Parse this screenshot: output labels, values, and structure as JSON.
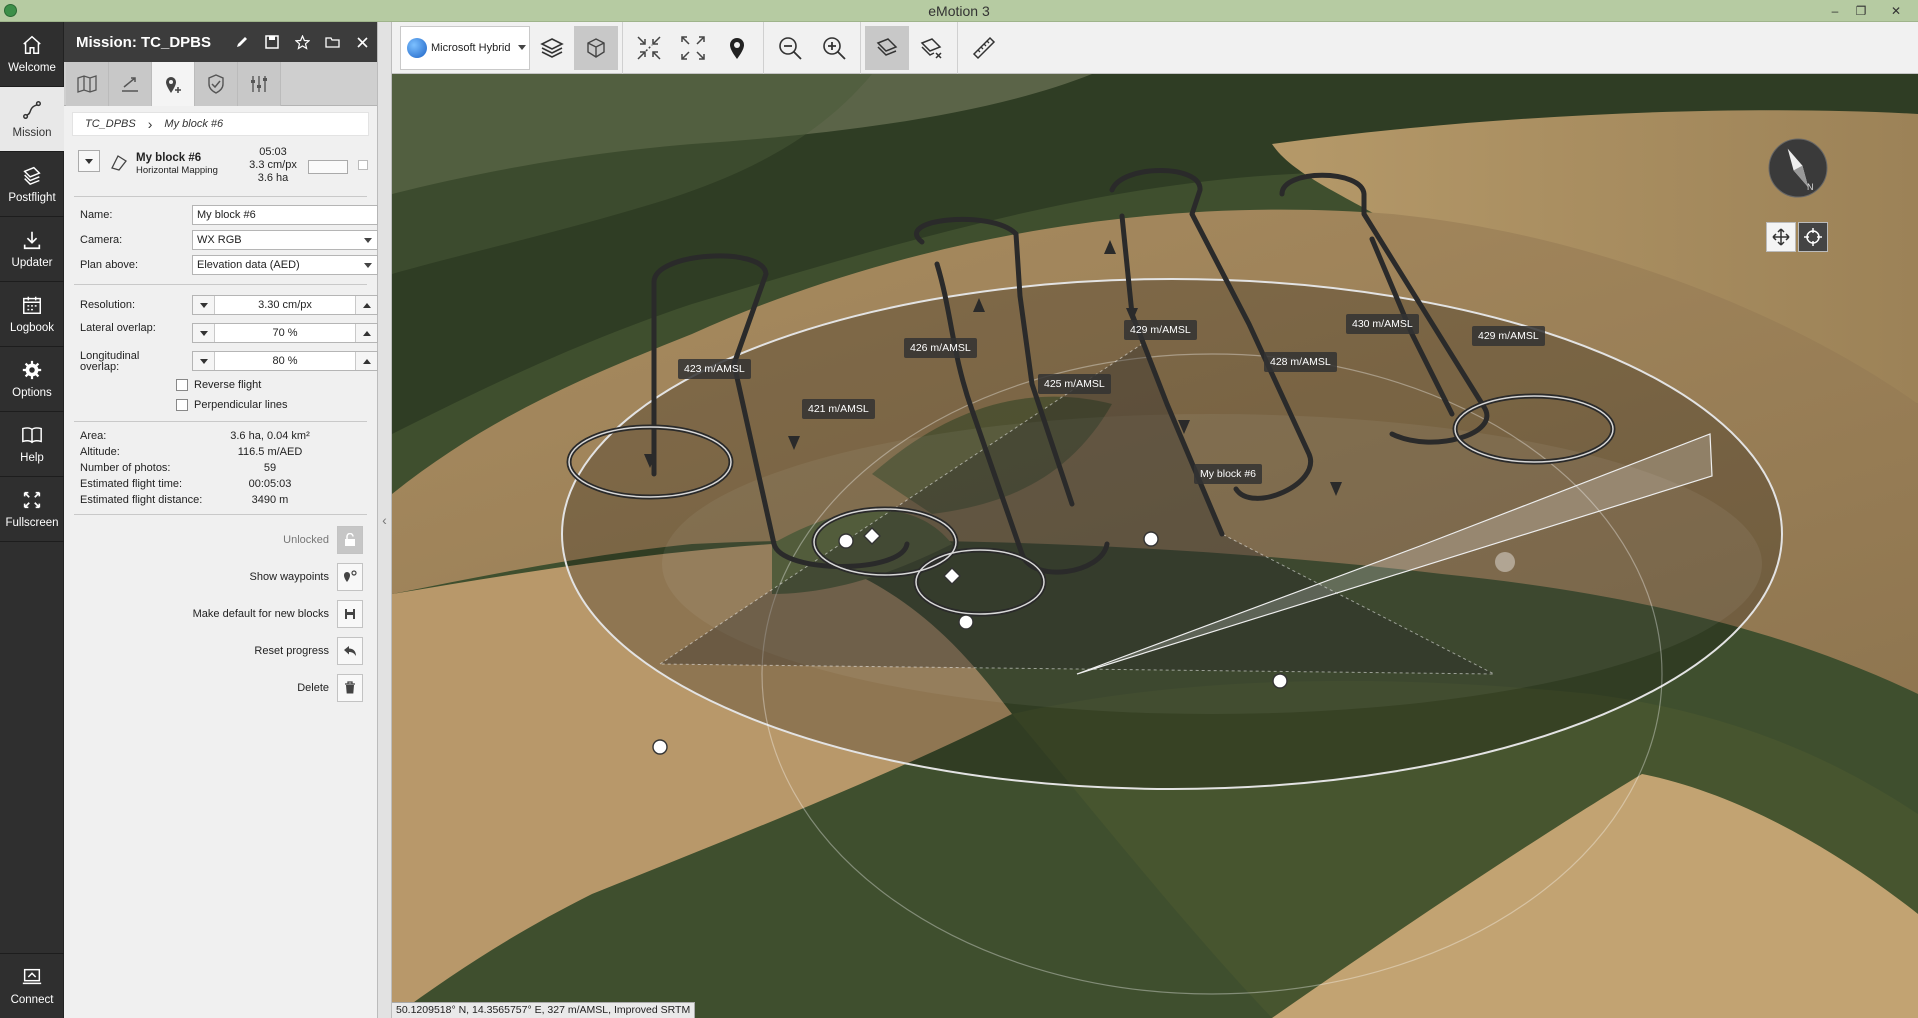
{
  "window": {
    "title": "eMotion 3"
  },
  "nav": {
    "welcome": "Welcome",
    "mission": "Mission",
    "postflight": "Postflight",
    "updater": "Updater",
    "logbook": "Logbook",
    "options": "Options",
    "help": "Help",
    "fullscreen": "Fullscreen",
    "connect": "Connect"
  },
  "panel": {
    "title": "Mission: TC_DPBS",
    "breadcrumb": [
      "TC_DPBS",
      "My block #6"
    ],
    "block": {
      "name": "My block #6",
      "type": "Horizontal Mapping",
      "time": "05:03",
      "resolution": "3.3 cm/px",
      "area": "3.6 ha"
    },
    "fields": {
      "name_label": "Name:",
      "name_value": "My block #6",
      "camera_label": "Camera:",
      "camera_value": "WX RGB",
      "plan_label": "Plan above:",
      "plan_value": "Elevation data (AED)",
      "resolution_label": "Resolution:",
      "resolution_value": "3.30 cm/px",
      "lateral_label": "Lateral overlap:",
      "lateral_value": "70 %",
      "longitudinal_label": "Longitudinal overlap:",
      "longitudinal_value": "80 %",
      "reverse_label": "Reverse flight",
      "perpendicular_label": "Perpendicular lines"
    },
    "info": {
      "area_label": "Area:",
      "area_value": "3.6 ha, 0.04 km²",
      "altitude_label": "Altitude:",
      "altitude_value": "116.5 m/AED",
      "photos_label": "Number of photos:",
      "photos_value": "59",
      "time_label": "Estimated flight time:",
      "time_value": "00:05:03",
      "distance_label": "Estimated flight distance:",
      "distance_value": "3490 m"
    },
    "actions": {
      "unlocked": "Unlocked",
      "show_waypoints": "Show waypoints",
      "make_default": "Make default for new blocks",
      "reset_progress": "Reset progress",
      "delete": "Delete"
    }
  },
  "toolbar": {
    "map_source": "Microsoft Hybrid"
  },
  "map": {
    "labels": {
      "a423": "423 m/AMSL",
      "a421": "421 m/AMSL",
      "a426": "426 m/AMSL",
      "a425": "425 m/AMSL",
      "a429a": "429 m/AMSL",
      "a428": "428 m/AMSL",
      "a430": "430 m/AMSL",
      "a429b": "429 m/AMSL",
      "block": "My block #6"
    },
    "status": "50.1209518° N, 14.3565757° E, 327 m/AMSL, Improved SRTM"
  },
  "colors": {
    "titlebar": "#b6cba2",
    "sidebar": "#2f2f2f",
    "panel_header": "#3c3c3c",
    "flight_path": "#2a2a2a"
  }
}
